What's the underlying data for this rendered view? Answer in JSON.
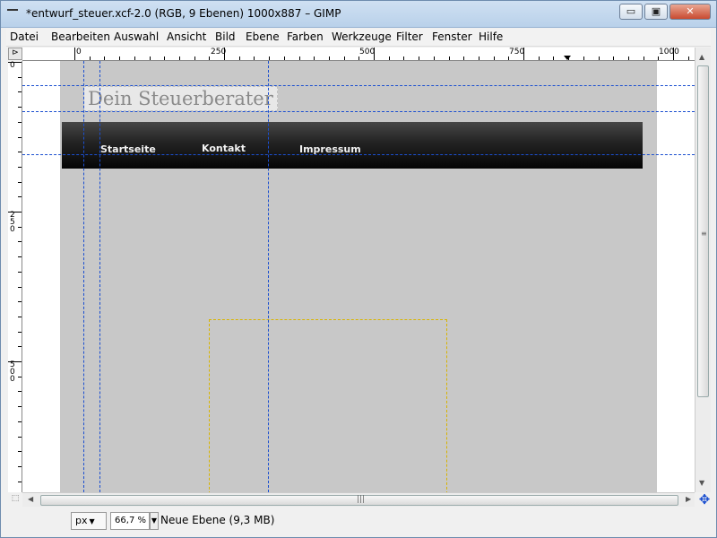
{
  "window": {
    "title": "*entwurf_steuer.xcf-2.0 (RGB, 9 Ebenen) 1000x887 – GIMP",
    "min_glyph": "▭",
    "max_glyph": "▣",
    "close_glyph": "✕"
  },
  "menu": {
    "items": [
      "Datei",
      "Bearbeiten",
      "Auswahl",
      "Ansicht",
      "Bild",
      "Ebene",
      "Farben",
      "Werkzeuge",
      "Filter",
      "Fenster",
      "Hilfe"
    ]
  },
  "rulers": {
    "top_labels": [
      "0",
      "250",
      "500",
      "750",
      "1000"
    ],
    "left_labels": [
      "0",
      "250",
      "500"
    ],
    "corner_glyph": "⊳"
  },
  "canvas": {
    "site_title": "Dein Steuerberater",
    "nav_links": [
      "Startseite",
      "Kontakt",
      "Impressum"
    ],
    "background_color": "#c8c8c8",
    "navbar_color": "#1a1a1a",
    "guide_color": "#1b4fd0",
    "selection_color": "#d8b400"
  },
  "scrollbars": {
    "up_glyph": "▲",
    "down_glyph": "▼",
    "left_glyph": "◀",
    "right_glyph": "▶",
    "grip_glyph": "|||",
    "navigate_glyph": "✥",
    "quickmask_glyph": "⬚"
  },
  "status": {
    "unit": "px",
    "zoom": "66,7 %",
    "zoom_arrow": "▼",
    "layer_info": "Neue Ebene (9,3 MB)"
  }
}
